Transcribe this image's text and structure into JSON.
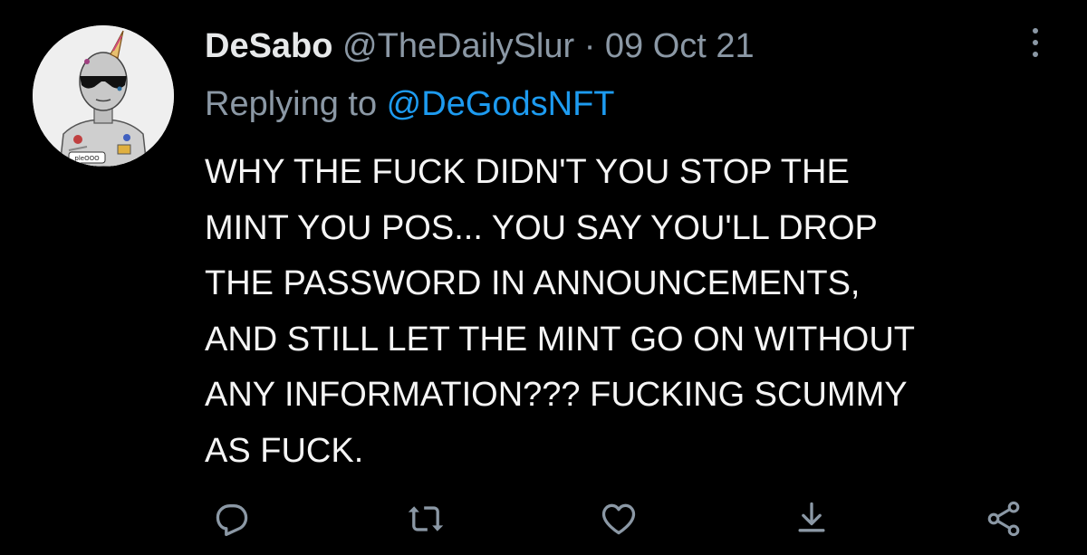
{
  "author": {
    "name": "DeSabo",
    "handle": "@TheDailySlur",
    "separator": "·",
    "date": "09 Oct 21"
  },
  "reply": {
    "prefix": "Replying to ",
    "mention": "@DeGodsNFT"
  },
  "tweet": {
    "text": "WHY THE FUCK DIDN'T YOU STOP THE\nMINT YOU POS... YOU SAY YOU'LL DROP\nTHE PASSWORD IN ANNOUNCEMENTS,\nAND STILL LET THE MINT GO ON WITHOUT\nANY INFORMATION??? FUCKING SCUMMY\nAS FUCK."
  },
  "avatar": {
    "badge_text": "pleOOO"
  },
  "actions": [
    {
      "icon": "reply-icon"
    },
    {
      "icon": "retweet-icon"
    },
    {
      "icon": "like-icon"
    },
    {
      "icon": "download-icon"
    },
    {
      "icon": "share-icon"
    }
  ],
  "colors": {
    "background": "#000000",
    "text": "#e7e9ea",
    "secondary": "#8b98a5",
    "link": "#1d9bf0"
  }
}
